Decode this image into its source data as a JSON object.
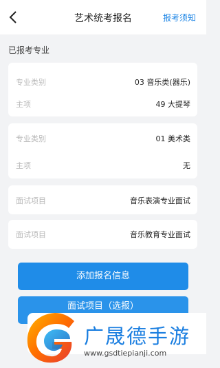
{
  "header": {
    "title": "艺术统考报名",
    "help_link": "报考须知"
  },
  "section_title": "已报考专业",
  "cards": [
    {
      "rows": [
        {
          "label": "专业类别",
          "value": "03 音乐类(器乐)"
        },
        {
          "label": "主项",
          "value": "49 大提琴"
        }
      ]
    },
    {
      "rows": [
        {
          "label": "专业类别",
          "value": "01 美术类"
        },
        {
          "label": "主项",
          "value": "无"
        }
      ]
    },
    {
      "rows": [
        {
          "label": "面试项目",
          "value": "音乐表演专业面试"
        }
      ]
    },
    {
      "rows": [
        {
          "label": "面试项目",
          "value": "音乐教育专业面试"
        }
      ]
    }
  ],
  "buttons": {
    "add_info": "添加报名信息",
    "interview_select": "面试项目（选报）"
  },
  "watermark": {
    "name": "广晟德手游",
    "url": "www.gsdtiepianji.com"
  },
  "colors": {
    "accent": "#1f8ce8",
    "background": "#f2f3f5",
    "label_gray": "#b9b9b9"
  }
}
